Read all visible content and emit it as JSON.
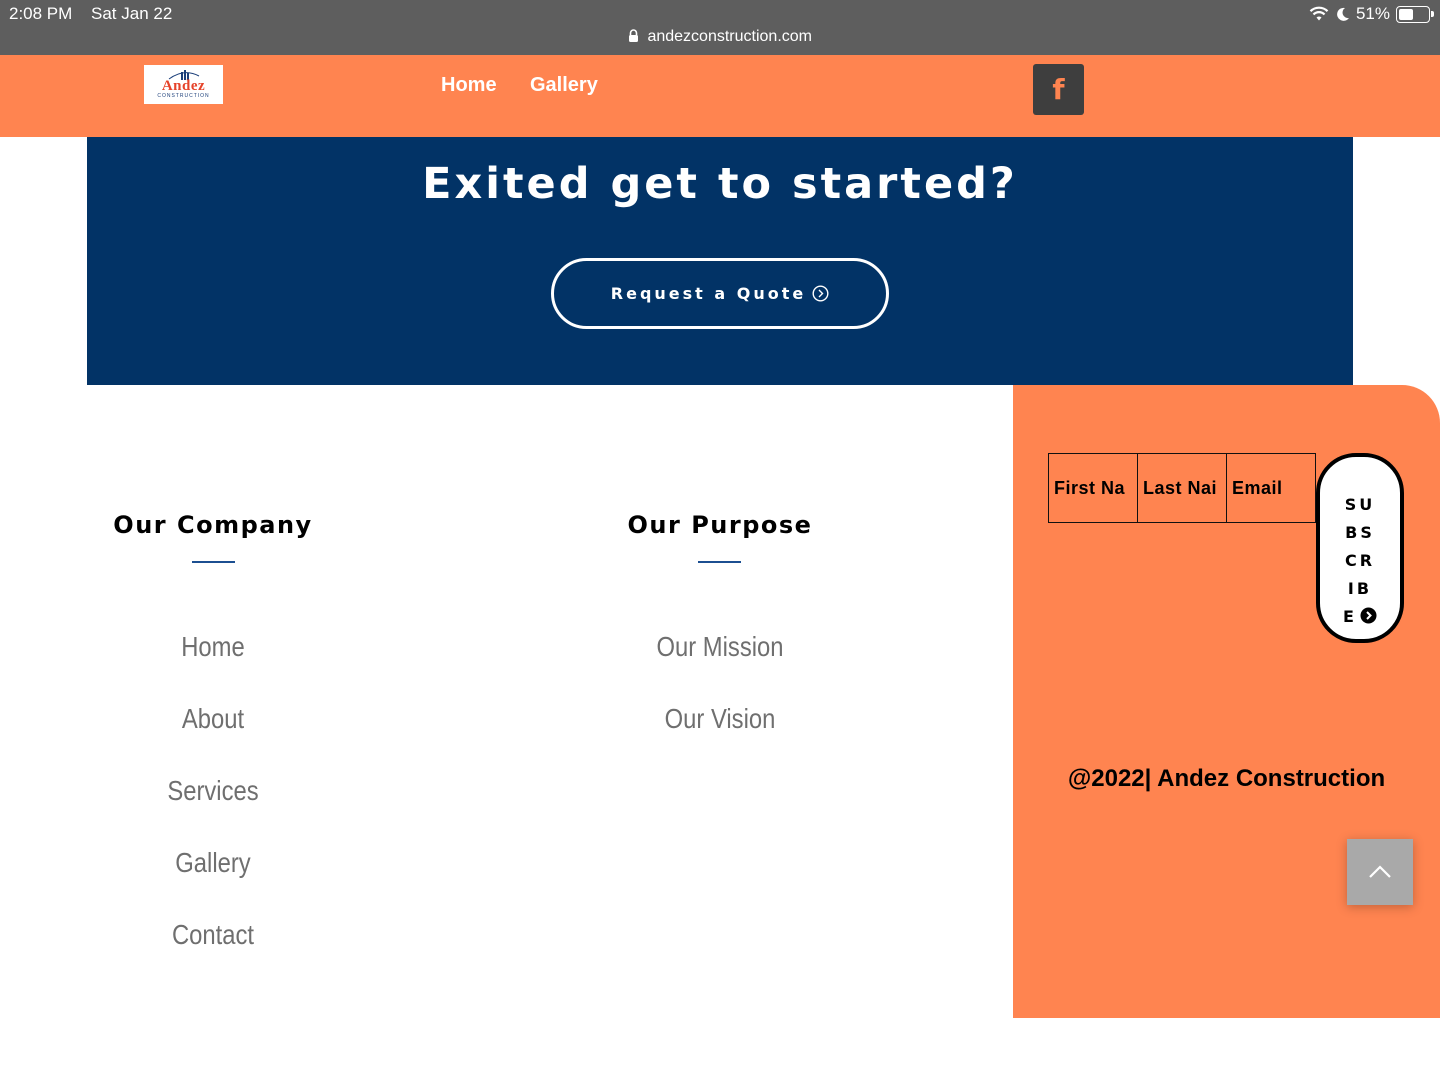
{
  "status": {
    "time": "2:08 PM",
    "date": "Sat Jan 22",
    "battery": "51%",
    "battery_level": 0.51,
    "url": "andezconstruction.com"
  },
  "nav": {
    "logo_text": "Andez",
    "logo_sub": "CONSTRUCTION",
    "links": [
      "Home",
      "Gallery"
    ],
    "social_label": "f"
  },
  "cta": {
    "title": "Exited get to started?",
    "button": "Request a Quote"
  },
  "footer": {
    "company": {
      "heading": "Our Company",
      "links": [
        "Home",
        "About",
        "Services",
        "Gallery",
        "Contact"
      ]
    },
    "purpose": {
      "heading": "Our Purpose",
      "links": [
        "Our Mission",
        "Our Vision"
      ]
    },
    "subscribe": {
      "fields": [
        "First Na",
        "Last Nai",
        "Email"
      ],
      "button_lines": [
        "SU",
        "BS",
        "CR",
        "IB",
        "E"
      ]
    },
    "copyright": "@2022| Andez Construction"
  },
  "colors": {
    "accent_orange": "#ff8450",
    "navy": "#023366",
    "dark_button": "#3e3e3e"
  }
}
